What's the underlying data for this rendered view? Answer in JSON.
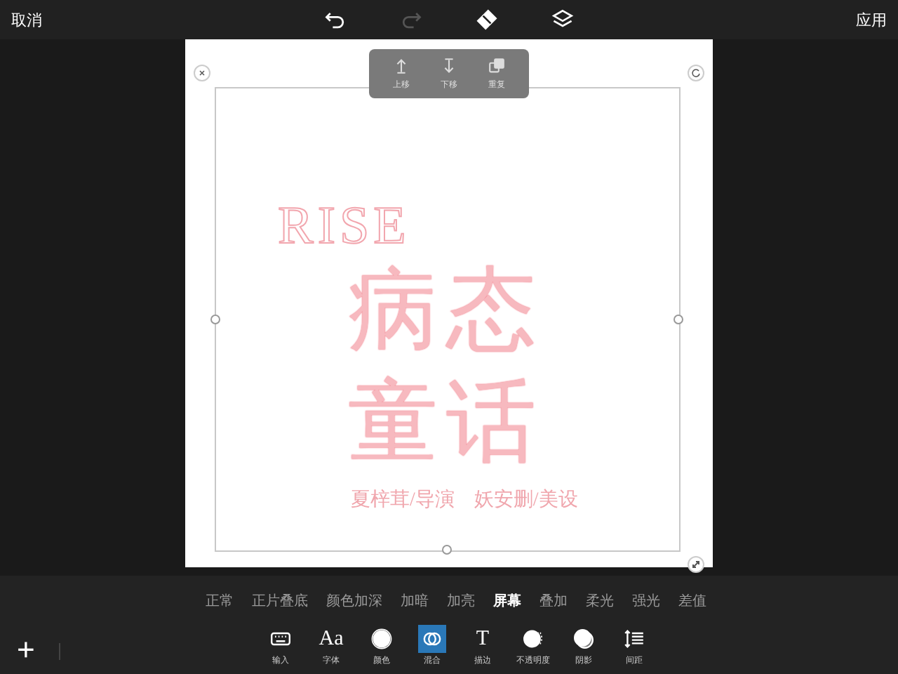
{
  "top_bar": {
    "cancel": "取消",
    "apply": "应用",
    "tools": [
      {
        "kind": "undo",
        "disabled": false
      },
      {
        "kind": "redo",
        "disabled": true
      },
      {
        "kind": "eraser",
        "disabled": false
      },
      {
        "kind": "layers",
        "disabled": false
      }
    ]
  },
  "popup_menu": [
    {
      "kind": "up",
      "label": "上移"
    },
    {
      "kind": "down",
      "label": "下移"
    },
    {
      "kind": "duplicate",
      "label": "重复"
    }
  ],
  "artwork": {
    "heading": "RISE",
    "title_lines": [
      "病态",
      "童话"
    ],
    "credits": "夏梓茸/导演　妖安删/美设"
  },
  "blend_modes": [
    {
      "label": "正常",
      "selected": false
    },
    {
      "label": "正片叠底",
      "selected": false
    },
    {
      "label": "颜色加深",
      "selected": false
    },
    {
      "label": "加暗",
      "selected": false
    },
    {
      "label": "加亮",
      "selected": false
    },
    {
      "label": "屏幕",
      "selected": true
    },
    {
      "label": "叠加",
      "selected": false
    },
    {
      "label": "柔光",
      "selected": false
    },
    {
      "label": "强光",
      "selected": false
    },
    {
      "label": "差值",
      "selected": false
    }
  ],
  "tools": [
    {
      "kind": "keyboard",
      "label": "输入",
      "selected": false
    },
    {
      "kind": "font",
      "label": "字体",
      "selected": false,
      "glyph": "Aa"
    },
    {
      "kind": "color",
      "label": "颜色",
      "selected": false
    },
    {
      "kind": "blend",
      "label": "混合",
      "selected": true
    },
    {
      "kind": "stroke",
      "label": "描边",
      "selected": false,
      "glyph": "T"
    },
    {
      "kind": "opacity",
      "label": "不透明度",
      "selected": false
    },
    {
      "kind": "shadow",
      "label": "阴影",
      "selected": false
    },
    {
      "kind": "spacing",
      "label": "间距",
      "selected": false
    }
  ],
  "add_button": "+"
}
